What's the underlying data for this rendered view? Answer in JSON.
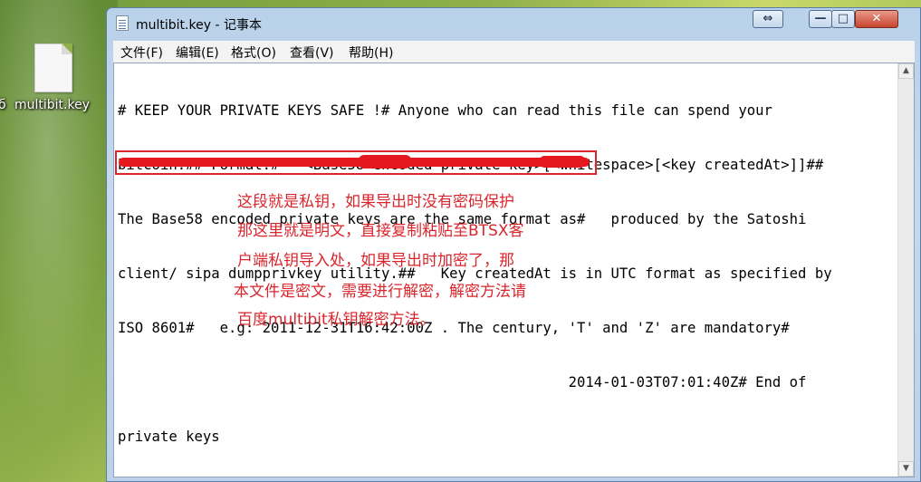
{
  "desktop": {
    "icon_label_fragment": "б",
    "icon_label": "multibit.key"
  },
  "window": {
    "title": "multibit.key - 记事本",
    "restore_glyph": "⇔",
    "minimize_glyph": "—",
    "maximize_glyph": "□",
    "close_glyph": "✕"
  },
  "menu": {
    "items": [
      "文件(F)",
      "编辑(E)",
      "格式(O)",
      "查看(V)",
      "帮助(H)"
    ]
  },
  "editor": {
    "lines": [
      "# KEEP YOUR PRIVATE KEYS SAFE !# Anyone who can read this file can spend your",
      "bitcoin.## Format:#   <Base58 encoded private key>[<whitespace>[<key createdAt>]]##",
      "The Base58 encoded private keys are the same format as#   produced by the Satoshi",
      "client/ sipa dumpprivkey utility.##   Key createdAt is in UTC format as specified by",
      "ISO 8601#   e.g: 2011-12-31T16:42:00Z . The century, 'T' and 'Z' are mandatory#",
      "                                                     2014-01-03T07:01:40Z# End of",
      "private keys"
    ]
  },
  "annotation": {
    "lines": [
      "这段就是私钥，如果导出时没有密码保护",
      "那这里就是明文，直接复制粘贴至BTSX客",
      "户端私钥导入处，如果导出时加密了，那",
      "本文件是密文，需要进行解密，解密方法请",
      "百度multibit私钥解密方法。"
    ],
    "color": "#d9252b"
  }
}
